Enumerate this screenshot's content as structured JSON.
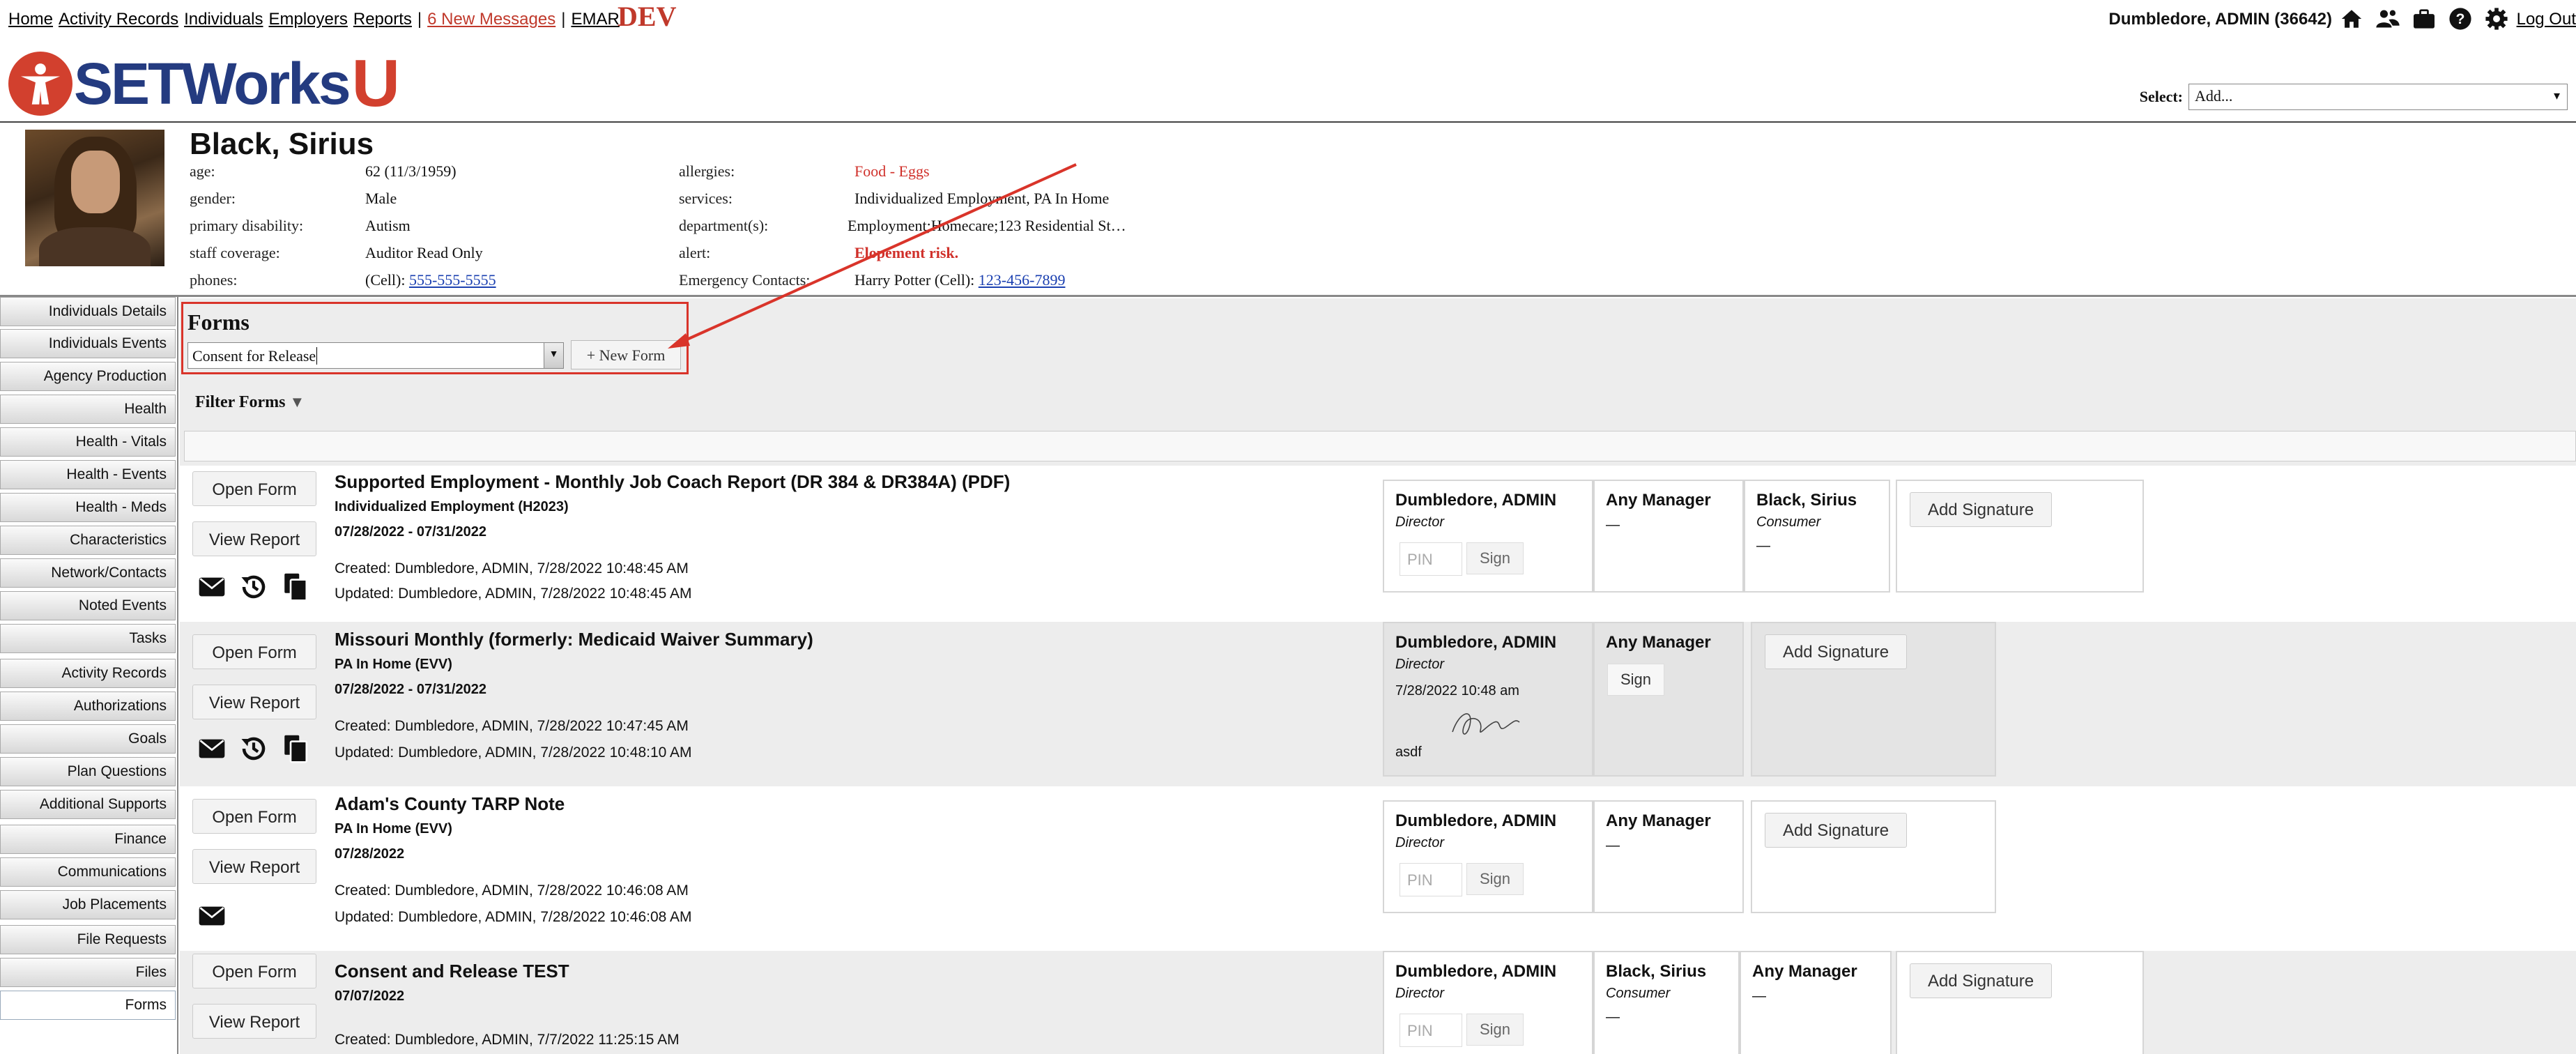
{
  "topnav": {
    "links": [
      "Home",
      "Activity Records",
      "Individuals",
      "Employers",
      "Reports"
    ],
    "messages": "6 New Messages",
    "emar": "EMAR",
    "dev": "DEV",
    "user": "Dumbledore, ADMIN  (36642)",
    "logout": "Log Out",
    "icons": [
      "home-icon",
      "people-icon",
      "briefcase-icon",
      "help-icon",
      "settings-icon"
    ]
  },
  "brand": {
    "name": "SETWorks",
    "suffix": "U"
  },
  "select": {
    "label": "Select:",
    "value": "Add..."
  },
  "profile": {
    "name": "Black, Sirius",
    "left": [
      {
        "k": "age:",
        "v": "62 (11/3/1959)"
      },
      {
        "k": "gender:",
        "v": "Male"
      },
      {
        "k": "primary disability:",
        "v": "Autism"
      },
      {
        "k": "staff coverage:",
        "v": "Auditor Read Only"
      },
      {
        "k": "phones:",
        "v": "(Cell): ",
        "link": "555-555-5555"
      }
    ],
    "right": [
      {
        "k": "allergies:",
        "v": "Food - Eggs"
      },
      {
        "k": "services:",
        "v": "Individualized Employment, PA In Home"
      },
      {
        "k": "department(s):",
        "v": "Employment;Homecare;123 Residential St…"
      },
      {
        "k": "alert:",
        "v": "Elopement risk."
      },
      {
        "k": "Emergency Contacts:",
        "v": "Harry Potter (Cell): ",
        "link": "123-456-7899"
      }
    ]
  },
  "sidebar": {
    "items": [
      "Individuals Details",
      "Individuals Events",
      "Agency Production",
      "Health",
      "Health - Vitals",
      "Health - Events",
      "Health - Meds",
      "Characteristics",
      "Network/Contacts",
      "Noted Events",
      "Tasks",
      "Activity Records",
      "Authorizations",
      "Goals",
      "Plan Questions",
      "Additional Supports",
      "Finance",
      "Communications",
      "Job Placements",
      "File Requests",
      "Files",
      "Forms"
    ],
    "active": "Forms"
  },
  "forms": {
    "title": "Forms",
    "combo_value": "Consent for Release",
    "new_form": "+ New Form",
    "filter": "Filter Forms",
    "filter_icon": "▼",
    "open_label": "Open Form",
    "view_label": "View Report",
    "created_label": "Created:",
    "updated_label": "Updated:"
  },
  "records": [
    {
      "title": "Supported Employment - Monthly Job Coach Report (DR 384 & DR384A) (PDF)",
      "service": "Individualized Employment (H2023)",
      "dates": "07/28/2022 - 07/31/2022",
      "created": "Dumbledore, ADMIN, 7/28/2022 10:48:45 AM",
      "updated": "Dumbledore, ADMIN, 7/28/2022 10:48:45 AM",
      "sigs": [
        {
          "name": "Dumbledore, ADMIN",
          "role": "Director",
          "pin": "PIN",
          "sign": "Sign"
        },
        {
          "name": "Any Manager",
          "dash": "—"
        },
        {
          "name": "Black, Sirius",
          "role": "Consumer",
          "dash": "—"
        },
        {
          "add": "Add Signature"
        }
      ]
    },
    {
      "title": "Missouri Monthly (formerly: Medicaid Waiver Summary)",
      "service": "PA In Home (EVV)",
      "dates": "07/28/2022 - 07/31/2022",
      "created": "Dumbledore, ADMIN, 7/28/2022 10:47:45 AM",
      "updated": "Dumbledore, ADMIN, 7/28/2022 10:48:10 AM",
      "sigs": [
        {
          "name": "Dumbledore, ADMIN",
          "role": "Director",
          "date": "7/28/2022 10:48 am",
          "written": "asdf"
        },
        {
          "name": "Any Manager",
          "sign": "Sign"
        },
        {
          "add": "Add Signature"
        }
      ]
    },
    {
      "title": "Adam's County TARP Note",
      "service": "PA In Home (EVV)",
      "dates": "07/28/2022",
      "created": "Dumbledore, ADMIN, 7/28/2022 10:46:08 AM",
      "updated": "Dumbledore, ADMIN, 7/28/2022 10:46:08 AM",
      "sigs": [
        {
          "name": "Dumbledore, ADMIN",
          "role": "Director",
          "pin": "PIN",
          "sign": "Sign"
        },
        {
          "name": "Any Manager",
          "dash": "—"
        },
        {
          "add": "Add Signature"
        }
      ]
    },
    {
      "title": "Consent and Release TEST",
      "dates": "07/07/2022",
      "created": "Dumbledore, ADMIN, 7/7/2022 11:25:15 AM",
      "sigs": [
        {
          "name": "Dumbledore, ADMIN",
          "role": "Director",
          "pin": "PIN",
          "sign": "Sign"
        },
        {
          "name": "Black, Sirius",
          "role": "Consumer",
          "dash": "—"
        },
        {
          "name": "Any Manager",
          "dash": "—"
        },
        {
          "add": "Add Signature"
        }
      ]
    }
  ],
  "colors": {
    "accent_red": "#d9342a",
    "brand_blue": "#243b80",
    "link_blue": "#1a3fb0"
  }
}
